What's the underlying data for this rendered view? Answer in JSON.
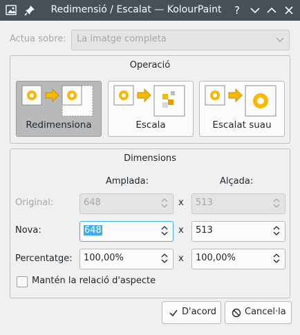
{
  "window": {
    "title": "Redimensió / Escalat — KolourPaint",
    "controls": [
      "help",
      "minimize",
      "maximize",
      "close"
    ],
    "help_glyph": "?"
  },
  "act_on": {
    "label": "Actua sobre:",
    "value": "La imatge completa",
    "enabled": false
  },
  "operation": {
    "title": "Operació",
    "options": [
      {
        "label": "Redimensiona",
        "active": true,
        "icon": "resize-icon"
      },
      {
        "label": "Escala",
        "active": false,
        "icon": "scale-icon"
      },
      {
        "label": "Escalat suau",
        "active": false,
        "icon": "smooth-scale-icon"
      }
    ]
  },
  "dimensions": {
    "title": "Dimensions",
    "width_header": "Amplada:",
    "height_header": "Alçada:",
    "separator": "x",
    "rows": {
      "original": {
        "label": "Original:",
        "width": "648",
        "height": "513",
        "enabled": false
      },
      "new": {
        "label": "Nova:",
        "width": "648",
        "height": "513"
      },
      "percent": {
        "label": "Percentatge:",
        "width": "100,00%",
        "height": "100,00%"
      }
    },
    "keep_aspect": {
      "label": "Mantén la relació d'aspecte",
      "checked": false
    }
  },
  "buttons": {
    "ok": "D'acord",
    "cancel": "Cancel·la"
  },
  "colors": {
    "titlebar": "#475057",
    "window_bg": "#eff0f1",
    "focus": "#3daee9",
    "arrow": "#f6b800"
  }
}
